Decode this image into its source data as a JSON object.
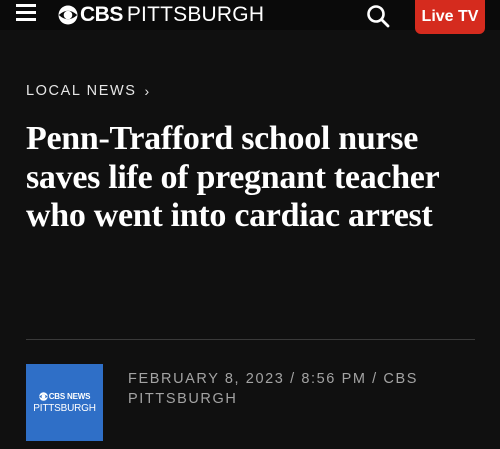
{
  "header": {
    "brand_cbs": "CBS",
    "brand_city": "PITTSBURGH",
    "live_label": "Live TV",
    "live_color": "#d52b1e"
  },
  "breadcrumb": {
    "label": "LOCAL NEWS",
    "chevron": "›"
  },
  "article": {
    "headline": "Penn-Trafford school nurse saves life of pregnant teacher who went into cardiac arrest",
    "dateline": "FEBRUARY 8, 2023 / 8:56 PM / CBS PITTSBURGH"
  },
  "source_logo": {
    "top_text": "CBS NEWS",
    "bottom_text": "PITTSBURGH",
    "background": "#2f6fc7"
  },
  "icons": {
    "menu": "hamburger-menu-icon",
    "brand": "cbs-eye-icon",
    "search": "search-icon"
  }
}
